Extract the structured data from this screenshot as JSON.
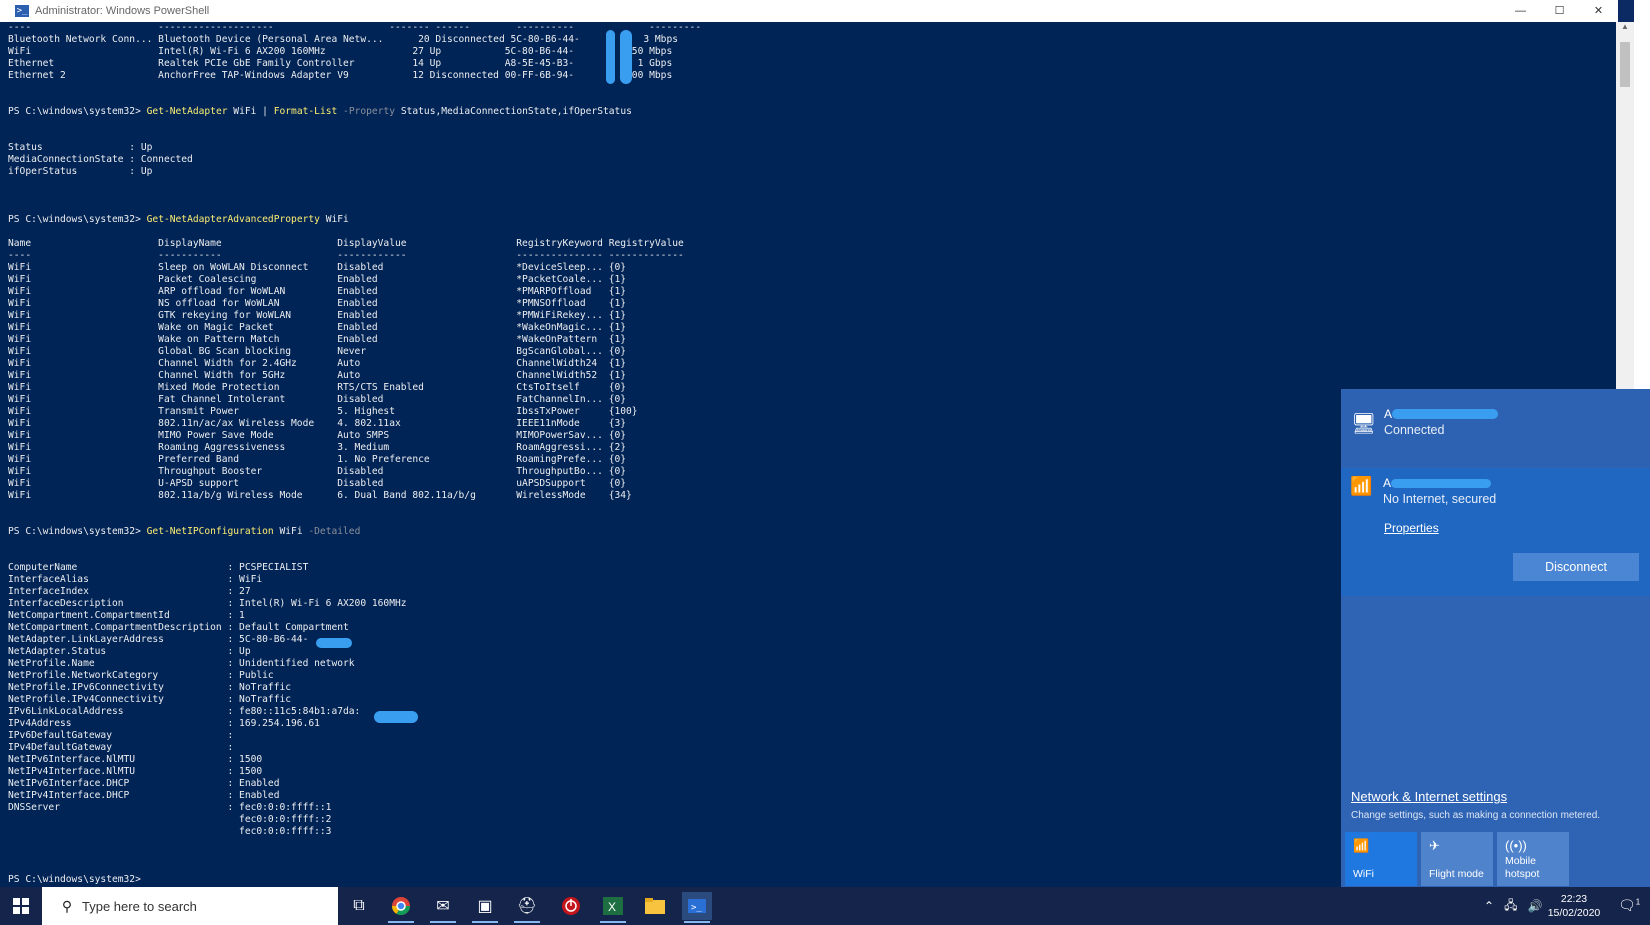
{
  "window": {
    "title": "Administrator: Windows PowerShell",
    "controls": [
      "—",
      "☐",
      "✕"
    ]
  },
  "console": {
    "adapter_rows": [
      "----                      --------------------                    ------- ------        ----------             ---------",
      "Bluetooth Network Conn... Bluetooth Device (Personal Area Netw...      20 Disconnected 5C-80-B6-44-           3 Mbps",
      "WiFi                      Intel(R) Wi-Fi 6 AX200 160MHz               27 Up           5C-80-B6-44-         650 Mbps",
      "Ethernet                  Realtek PCIe GbE Family Controller          14 Up           A8-5E-45-B3-           1 Gbps",
      "Ethernet 2                AnchorFree TAP-Windows Adapter V9           12 Disconnected 00-FF-6B-94-         100 Mbps"
    ],
    "prompt": "PS C:\\windows\\system32>",
    "cmd1": {
      "cmd": "Get-NetAdapter",
      "arg": " WiFi | ",
      "cmd_b": "Format-List",
      "param": " -Property ",
      "rest": "Status,MediaConnectionState,ifOperStatus"
    },
    "fl_output": [
      "Status               : Up",
      "MediaConnectionState : Connected",
      "ifOperStatus         : Up"
    ],
    "cmd2": {
      "cmd": "Get-NetAdapterAdvancedProperty",
      "arg": " WiFi"
    },
    "adv_header": [
      "Name                      DisplayName                    DisplayValue                   RegistryKeyword RegistryValue",
      "----                      -----------                    ------------                   --------------- -------------"
    ],
    "adv_rows": [
      "WiFi                      Sleep on WoWLAN Disconnect     Disabled                       *DeviceSleep... {0}",
      "WiFi                      Packet Coalescing              Enabled                        *PacketCoale... {1}",
      "WiFi                      ARP offload for WoWLAN         Enabled                        *PMARPOffload   {1}",
      "WiFi                      NS offload for WoWLAN          Enabled                        *PMNSOffload    {1}",
      "WiFi                      GTK rekeying for WoWLAN        Enabled                        *PMWiFiRekey... {1}",
      "WiFi                      Wake on Magic Packet           Enabled                        *WakeOnMagic... {1}",
      "WiFi                      Wake on Pattern Match          Enabled                        *WakeOnPattern  {1}",
      "WiFi                      Global BG Scan blocking        Never                          BgScanGlobal... {0}",
      "WiFi                      Channel Width for 2.4GHz       Auto                           ChannelWidth24  {1}",
      "WiFi                      Channel Width for 5GHz         Auto                           ChannelWidth52  {1}",
      "WiFi                      Mixed Mode Protection          RTS/CTS Enabled                CtsToItself     {0}",
      "WiFi                      Fat Channel Intolerant         Disabled                       FatChannelIn... {0}",
      "WiFi                      Transmit Power                 5. Highest                     IbssTxPower     {100}",
      "WiFi                      802.11n/ac/ax Wireless Mode    4. 802.11ax                    IEEE11nMode     {3}",
      "WiFi                      MIMO Power Save Mode           Auto SMPS                      MIMOPowerSav... {0}",
      "WiFi                      Roaming Aggressiveness         3. Medium                      RoamAggressi... {2}",
      "WiFi                      Preferred Band                 1. No Preference               RoamingPrefe... {0}",
      "WiFi                      Throughput Booster             Disabled                       ThroughputBo... {0}",
      "WiFi                      U-APSD support                 Disabled                       uAPSDSupport    {0}",
      "WiFi                      802.11a/b/g Wireless Mode      6. Dual Band 802.11a/b/g       WirelessMode    {34}"
    ],
    "cmd3": {
      "cmd": "Get-NetIPConfiguration",
      "arg": " WiFi ",
      "param": "-Detailed"
    },
    "ip_rows": [
      "ComputerName                          : PCSPECIALIST",
      "InterfaceAlias                        : WiFi",
      "InterfaceIndex                        : 27",
      "InterfaceDescription                  : Intel(R) Wi-Fi 6 AX200 160MHz",
      "NetCompartment.CompartmentId          : 1",
      "NetCompartment.CompartmentDescription : Default Compartment",
      "NetAdapter.LinkLayerAddress           : 5C-80-B6-44-",
      "NetAdapter.Status                     : Up",
      "NetProfile.Name                       : Unidentified network",
      "NetProfile.NetworkCategory            : Public",
      "NetProfile.IPv6Connectivity           : NoTraffic",
      "NetProfile.IPv4Connectivity           : NoTraffic",
      "IPv6LinkLocalAddress                  : fe80::11c5:84b1:a7da:",
      "IPv4Address                           : 169.254.196.61",
      "IPv6DefaultGateway                    :",
      "IPv4DefaultGateway                    :",
      "NetIPv6Interface.NlMTU                : 1500",
      "NetIPv4Interface.NlMTU                : 1500",
      "NetIPv6Interface.DHCP                 : Enabled",
      "NetIPv4Interface.DHCP                 : Enabled",
      "DNSServer                             : fec0:0:0:ffff::1",
      "                                        fec0:0:0:ffff::2",
      "                                        fec0:0:0:ffff::3"
    ]
  },
  "network_flyout": {
    "net1": {
      "name": "A",
      "status": "Connected"
    },
    "net2": {
      "name": "A",
      "status": "No Internet, secured",
      "properties": "Properties",
      "disconnect": "Disconnect"
    },
    "settings_link": "Network & Internet settings",
    "settings_desc": "Change settings, such as making a connection metered.",
    "quick_actions": [
      {
        "label": "WiFi",
        "icon": "wifi-icon"
      },
      {
        "label": "Flight mode",
        "icon": "airplane-icon"
      },
      {
        "label": "Mobile hotspot",
        "icon": "hotspot-icon"
      }
    ]
  },
  "taskbar": {
    "search_placeholder": "Type here to search",
    "time": "22:23",
    "date": "15/02/2020",
    "notification_count": "1"
  },
  "colors": {
    "console_bg": "#012456",
    "command": "#fcee71",
    "parameter": "#8a8f9a",
    "flyout_bg": "#2f64b4",
    "taskbar_bg": "#15244a"
  }
}
